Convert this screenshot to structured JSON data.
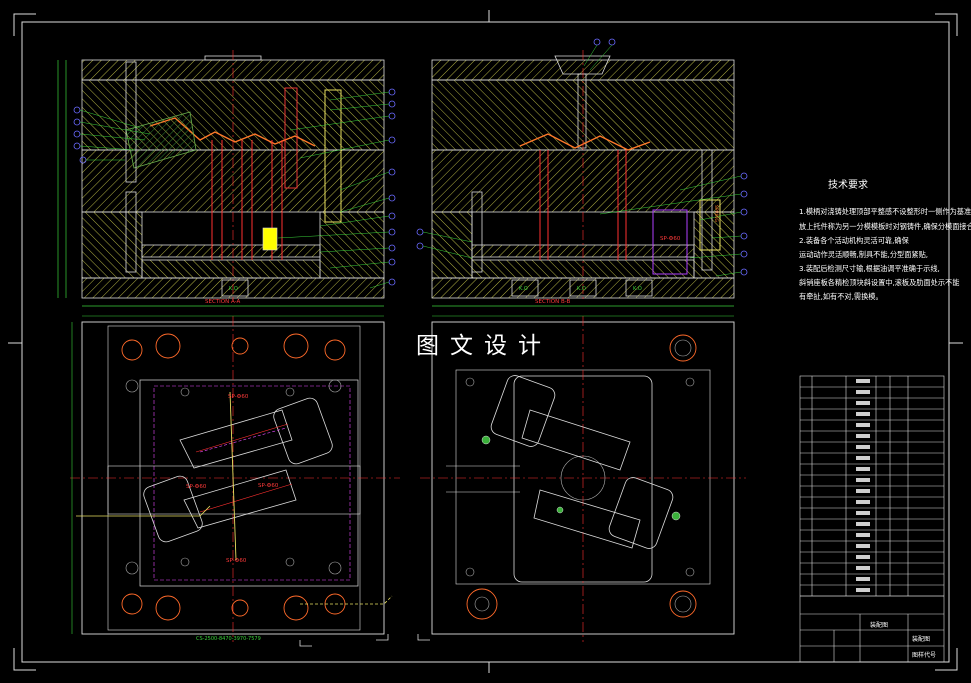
{
  "watermark": "图文设计",
  "tech_requirements": {
    "title": "技术要求",
    "lines": [
      "1.模柄对浇铸处理顶部平整感不设整形时一侧作为基准,",
      "放上托件称为另一分模模板时对钢铸件,确保分模面接合整线,",
      "2.装备各个活动机构灵活可靠,确保",
      "运动动作灵活顺畅,制具不能,分型面紧贴,",
      "3.装配后检测尺寸输,根据油调平准确于示线,",
      "斜销座板各精检顶块斜设置中,滚板及肋面处示不能",
      "有牵扯,如有不对,需换模。"
    ]
  },
  "section_labels": {
    "left_section": "SECTION A-A",
    "right_section": "SECTION B-B",
    "bottom_section": "CS-2500-8470-3970-7579"
  },
  "labels": {
    "spring_right": "SPRING",
    "sprue_label": "SP-Ф60",
    "left_top_sp": "SP-Ф60",
    "left_mid_sp1": "SP-Ф60",
    "left_mid_sp2": "SP-Ф60",
    "left_low_sp": "SP-Ф60",
    "kd1": "K.O",
    "kd2": "K.O",
    "kd3": "K.O",
    "kd4": "K.O"
  },
  "title_block": {
    "name_cell": "装配图",
    "drawing_cell": "装配图",
    "code_cell": "图样代号"
  }
}
